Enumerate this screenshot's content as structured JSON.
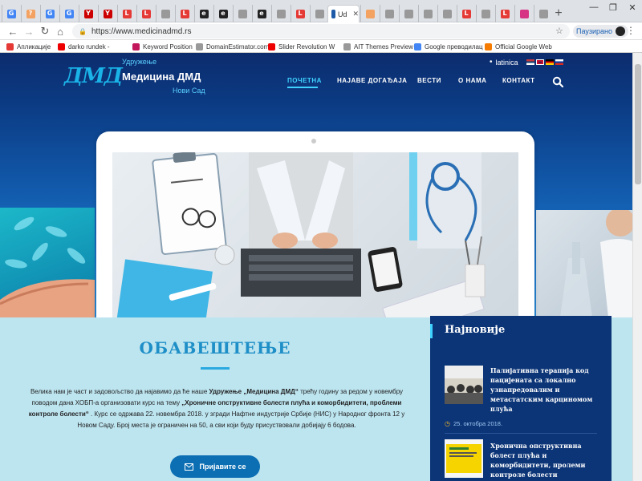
{
  "browser": {
    "url": "https://www.medicinadmd.rs",
    "active_tab_label": "Ud",
    "paused_label": "Паузирано",
    "tabs": [
      {
        "icon": "google-icon",
        "letter": "G",
        "color": "#4285f4"
      },
      {
        "icon": "tab-generic-icon",
        "letter": "?",
        "color": "#f4a261"
      },
      {
        "icon": "google-icon",
        "letter": "G",
        "color": "#4285f4"
      },
      {
        "icon": "google-icon",
        "letter": "G",
        "color": "#4285f4"
      },
      {
        "icon": "yandex-icon",
        "letter": "Y",
        "color": "#c00"
      },
      {
        "icon": "yandex-icon",
        "letter": "Y",
        "color": "#c00"
      },
      {
        "icon": "tab-red-icon",
        "letter": "L",
        "color": "#e53935"
      },
      {
        "icon": "tab-red-icon",
        "letter": "L",
        "color": "#e53935"
      },
      {
        "icon": "tab-doc-icon",
        "letter": "",
        "color": "#999"
      },
      {
        "icon": "tab-red-icon",
        "letter": "L",
        "color": "#e53935"
      },
      {
        "icon": "tab-black-icon",
        "letter": "e",
        "color": "#222"
      },
      {
        "icon": "tab-black-icon",
        "letter": "e",
        "color": "#222"
      },
      {
        "icon": "tab-doc-icon",
        "letter": "",
        "color": "#999"
      },
      {
        "icon": "tab-black-icon",
        "letter": "e",
        "color": "#222"
      },
      {
        "icon": "tab-doc-icon",
        "letter": "",
        "color": "#999"
      },
      {
        "icon": "tab-red-icon",
        "letter": "L",
        "color": "#e53935"
      },
      {
        "icon": "tab-doc-icon",
        "letter": "",
        "color": "#999"
      }
    ],
    "tabs_right": [
      {
        "icon": "tab-orange-icon",
        "letter": "",
        "color": "#f4a261"
      },
      {
        "icon": "tab-doc-icon",
        "letter": "",
        "color": "#999"
      },
      {
        "icon": "tab-doc-icon",
        "letter": "",
        "color": "#999"
      },
      {
        "icon": "tab-doc-icon",
        "letter": "",
        "color": "#999"
      },
      {
        "icon": "tab-doc-icon",
        "letter": "",
        "color": "#999"
      },
      {
        "icon": "tab-red-icon",
        "letter": "L",
        "color": "#e53935"
      },
      {
        "icon": "tab-doc-icon",
        "letter": "",
        "color": "#999"
      },
      {
        "icon": "tab-red-icon",
        "letter": "L",
        "color": "#e53935"
      },
      {
        "icon": "tab-pink-icon",
        "letter": "",
        "color": "#d63384"
      },
      {
        "icon": "tab-doc-icon",
        "letter": "",
        "color": "#999"
      }
    ],
    "bookmarks": [
      {
        "label": "Апликације",
        "icon": "apps-grid-icon",
        "color": "#e53935"
      },
      {
        "label": "darko rundek - ",
        "icon": "youtube-icon",
        "color": "#e00"
      },
      {
        "label": "Keyword Position",
        "icon": "s-logo-icon",
        "color": "#c2185b"
      },
      {
        "label": "DomainEstimator.com",
        "icon": "doc-icon",
        "color": "#999"
      },
      {
        "label": "Slider Revolution W",
        "icon": "youtube-icon",
        "color": "#e00"
      },
      {
        "label": "AIT Themes Preview",
        "icon": "doc-icon",
        "color": "#999"
      },
      {
        "label": "Google преводилац",
        "icon": "translate-icon",
        "color": "#4285f4"
      },
      {
        "label": "Official Google Web",
        "icon": "blogger-icon",
        "color": "#f57c00"
      }
    ]
  },
  "site": {
    "logo_text": "ДМД",
    "org_top": "Удружење",
    "org_name": "Медицина ДМД",
    "org_city": "Нови Сад",
    "lang_label": "latinica",
    "nav": [
      "ПОЧЕТНА",
      "НАЈАВЕ ДОГАЂАЈА",
      "ВЕСТИ",
      "О НАМА",
      "КОНТАКТ"
    ],
    "colors": {
      "accent": "#3fd2ff",
      "header": "#0c3577",
      "button": "#0c6fb3"
    }
  },
  "notice": {
    "title": "ОБАВЕШТЕЊЕ",
    "p1": "Велика нам је част и задовољство да најавимо да ће наше ",
    "p1_bold": "Удружење „Медицина ДМД“",
    "p2": " трећу годину за редом у новембру поводом дана ХОБП-а организовати курс на тему ",
    "p2_bold": "„Хроничне опструктивне болести плућа и коморбидитети, проблеми контроле болести“",
    "p3": " . Курс се одржава 22. новембра 2018. у згради Нафтне индустрије Србије (НИС) у Народног фронта 12 у Новом Саду. Број места је ограничен на 50, а сви који буду присуствовали добијају 6 бодова.",
    "button": "Пријавите се"
  },
  "sidebar": {
    "title": "Најновије",
    "posts": [
      {
        "title": "Палијативна терапија код пацијената са локално узнапредовалим и метастатским карциномом плућа",
        "date": "25. октобра 2018."
      },
      {
        "title": "Хронична опструктивна болест плућа и коморбидитети, пролеми контроле болести",
        "date": ""
      }
    ]
  }
}
